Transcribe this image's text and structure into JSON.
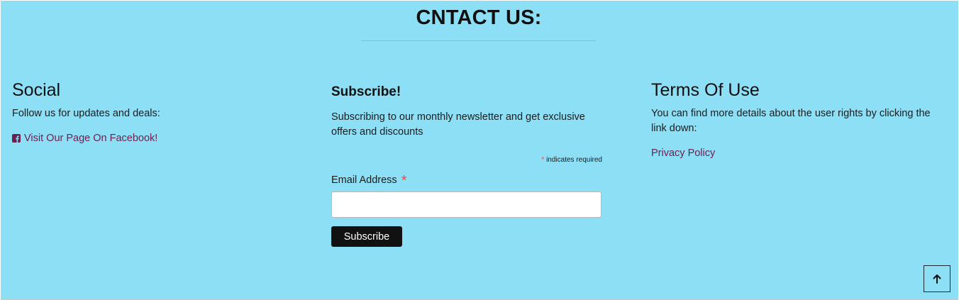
{
  "section": {
    "heading": "CNTACT US:"
  },
  "social": {
    "title": "Social",
    "description": "Follow us for updates and deals:",
    "facebook_icon": "facebook-square-icon",
    "facebook_link": "Visit Our Page On Facebook!"
  },
  "subscribe": {
    "title": "Subscribe!",
    "description": "Subscribing to our monthly newsletter and get exclusive offers and discounts",
    "required_star": "*",
    "required_note": "indicates required",
    "email_label": "Email Address",
    "email_value": "",
    "button_label": "Subscribe"
  },
  "terms": {
    "title": "Terms Of Use",
    "description": "You can find more details about the user rights by clicking the link down:",
    "privacy_link": "Privacy Policy"
  },
  "scroll_top": {
    "icon": "arrow-up-icon"
  },
  "colors": {
    "background": "#8ddff6",
    "link": "#6d1f4d",
    "button": "#111111",
    "required": "#e0514a"
  }
}
